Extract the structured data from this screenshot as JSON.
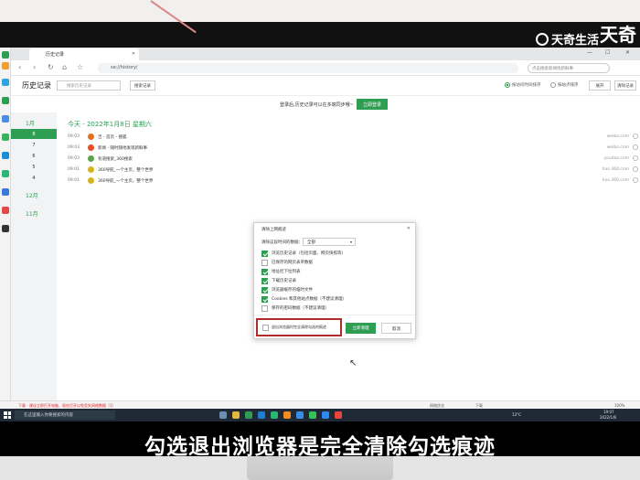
{
  "watermark": {
    "brand": "天奇生活",
    "corner": "天奇"
  },
  "browser": {
    "tab_title": "历史记录",
    "url": "se://history/",
    "search_placeholder": "点击搜索新闻找新鲜事"
  },
  "history": {
    "title": "历史记录",
    "search_placeholder": "搜索历史记录",
    "search_button": "搜索记录",
    "radio_by_time": "按访问时间排序",
    "radio_by_site": "按站点排序",
    "btn_expand": "展开",
    "btn_clear": "清除记录",
    "sync_message": "登录后,历史记录可以在多端同步哦~",
    "sync_button": "立即登录"
  },
  "timeline": {
    "month_current": "1月",
    "days": [
      "8",
      "7",
      "6",
      "5",
      "4"
    ],
    "month_dec": "12月",
    "month_nov": "11月"
  },
  "today_label": "今天 - 2022年1月8日 星期六",
  "rows": [
    {
      "time": "09:03",
      "name": "吉 - 首页 - 搜狐",
      "domain": "weibo.com",
      "color": "#e0701e"
    },
    {
      "time": "09:03",
      "name": "新闻 - 随时随地发现新鲜事",
      "domain": "weibo.com",
      "color": "#e44d26"
    },
    {
      "time": "09:03",
      "name": "有道搜索_360搜索",
      "domain": "youdao.com",
      "color": "#5aa34a"
    },
    {
      "time": "09:01",
      "name": "360导航_一个主页，整个世界",
      "domain": "hao.360.com",
      "color": "#d6b21e"
    },
    {
      "time": "09:01",
      "name": "360导航_一个主页，整个世界",
      "domain": "hao.360.com",
      "color": "#d6b21e"
    }
  ],
  "dialog": {
    "title": "清除上网痕迹",
    "range_label": "清除这段时间的数据：",
    "range_value": "全部",
    "options": [
      {
        "label": "浏览历史记录（包括页面、网页快照等）",
        "checked": true
      },
      {
        "label": "已保存的网页表单数据",
        "checked": false
      },
      {
        "label": "地址栏下拉列表",
        "checked": true
      },
      {
        "label": "下载历史记录",
        "checked": true
      },
      {
        "label": "浏览器缓存的临时文件",
        "checked": true
      },
      {
        "label": "Cookies 和其他站点数据（不建议清理）",
        "checked": true
      },
      {
        "label": "保存的密码数据（不建议清理）",
        "checked": false
      }
    ],
    "exit_option": "退出浏览器时完全清除勾选的痕迹",
    "clear_button": "立即清理",
    "cancel_button": "取消"
  },
  "download_bar": {
    "text": "下载 - 建议立即打开电脑，现在打开以免丢失网络数据（1）",
    "right1": "网络优化",
    "right2": "下载",
    "right3": "100%"
  },
  "taskbar": {
    "search_placeholder": "在这里输入你要搜索的内容",
    "weather": "13°C",
    "clock_time": "19:07",
    "clock_date": "2022/1/8"
  },
  "subtitle": "勾选退出浏览器是完全清除勾选痕迹"
}
